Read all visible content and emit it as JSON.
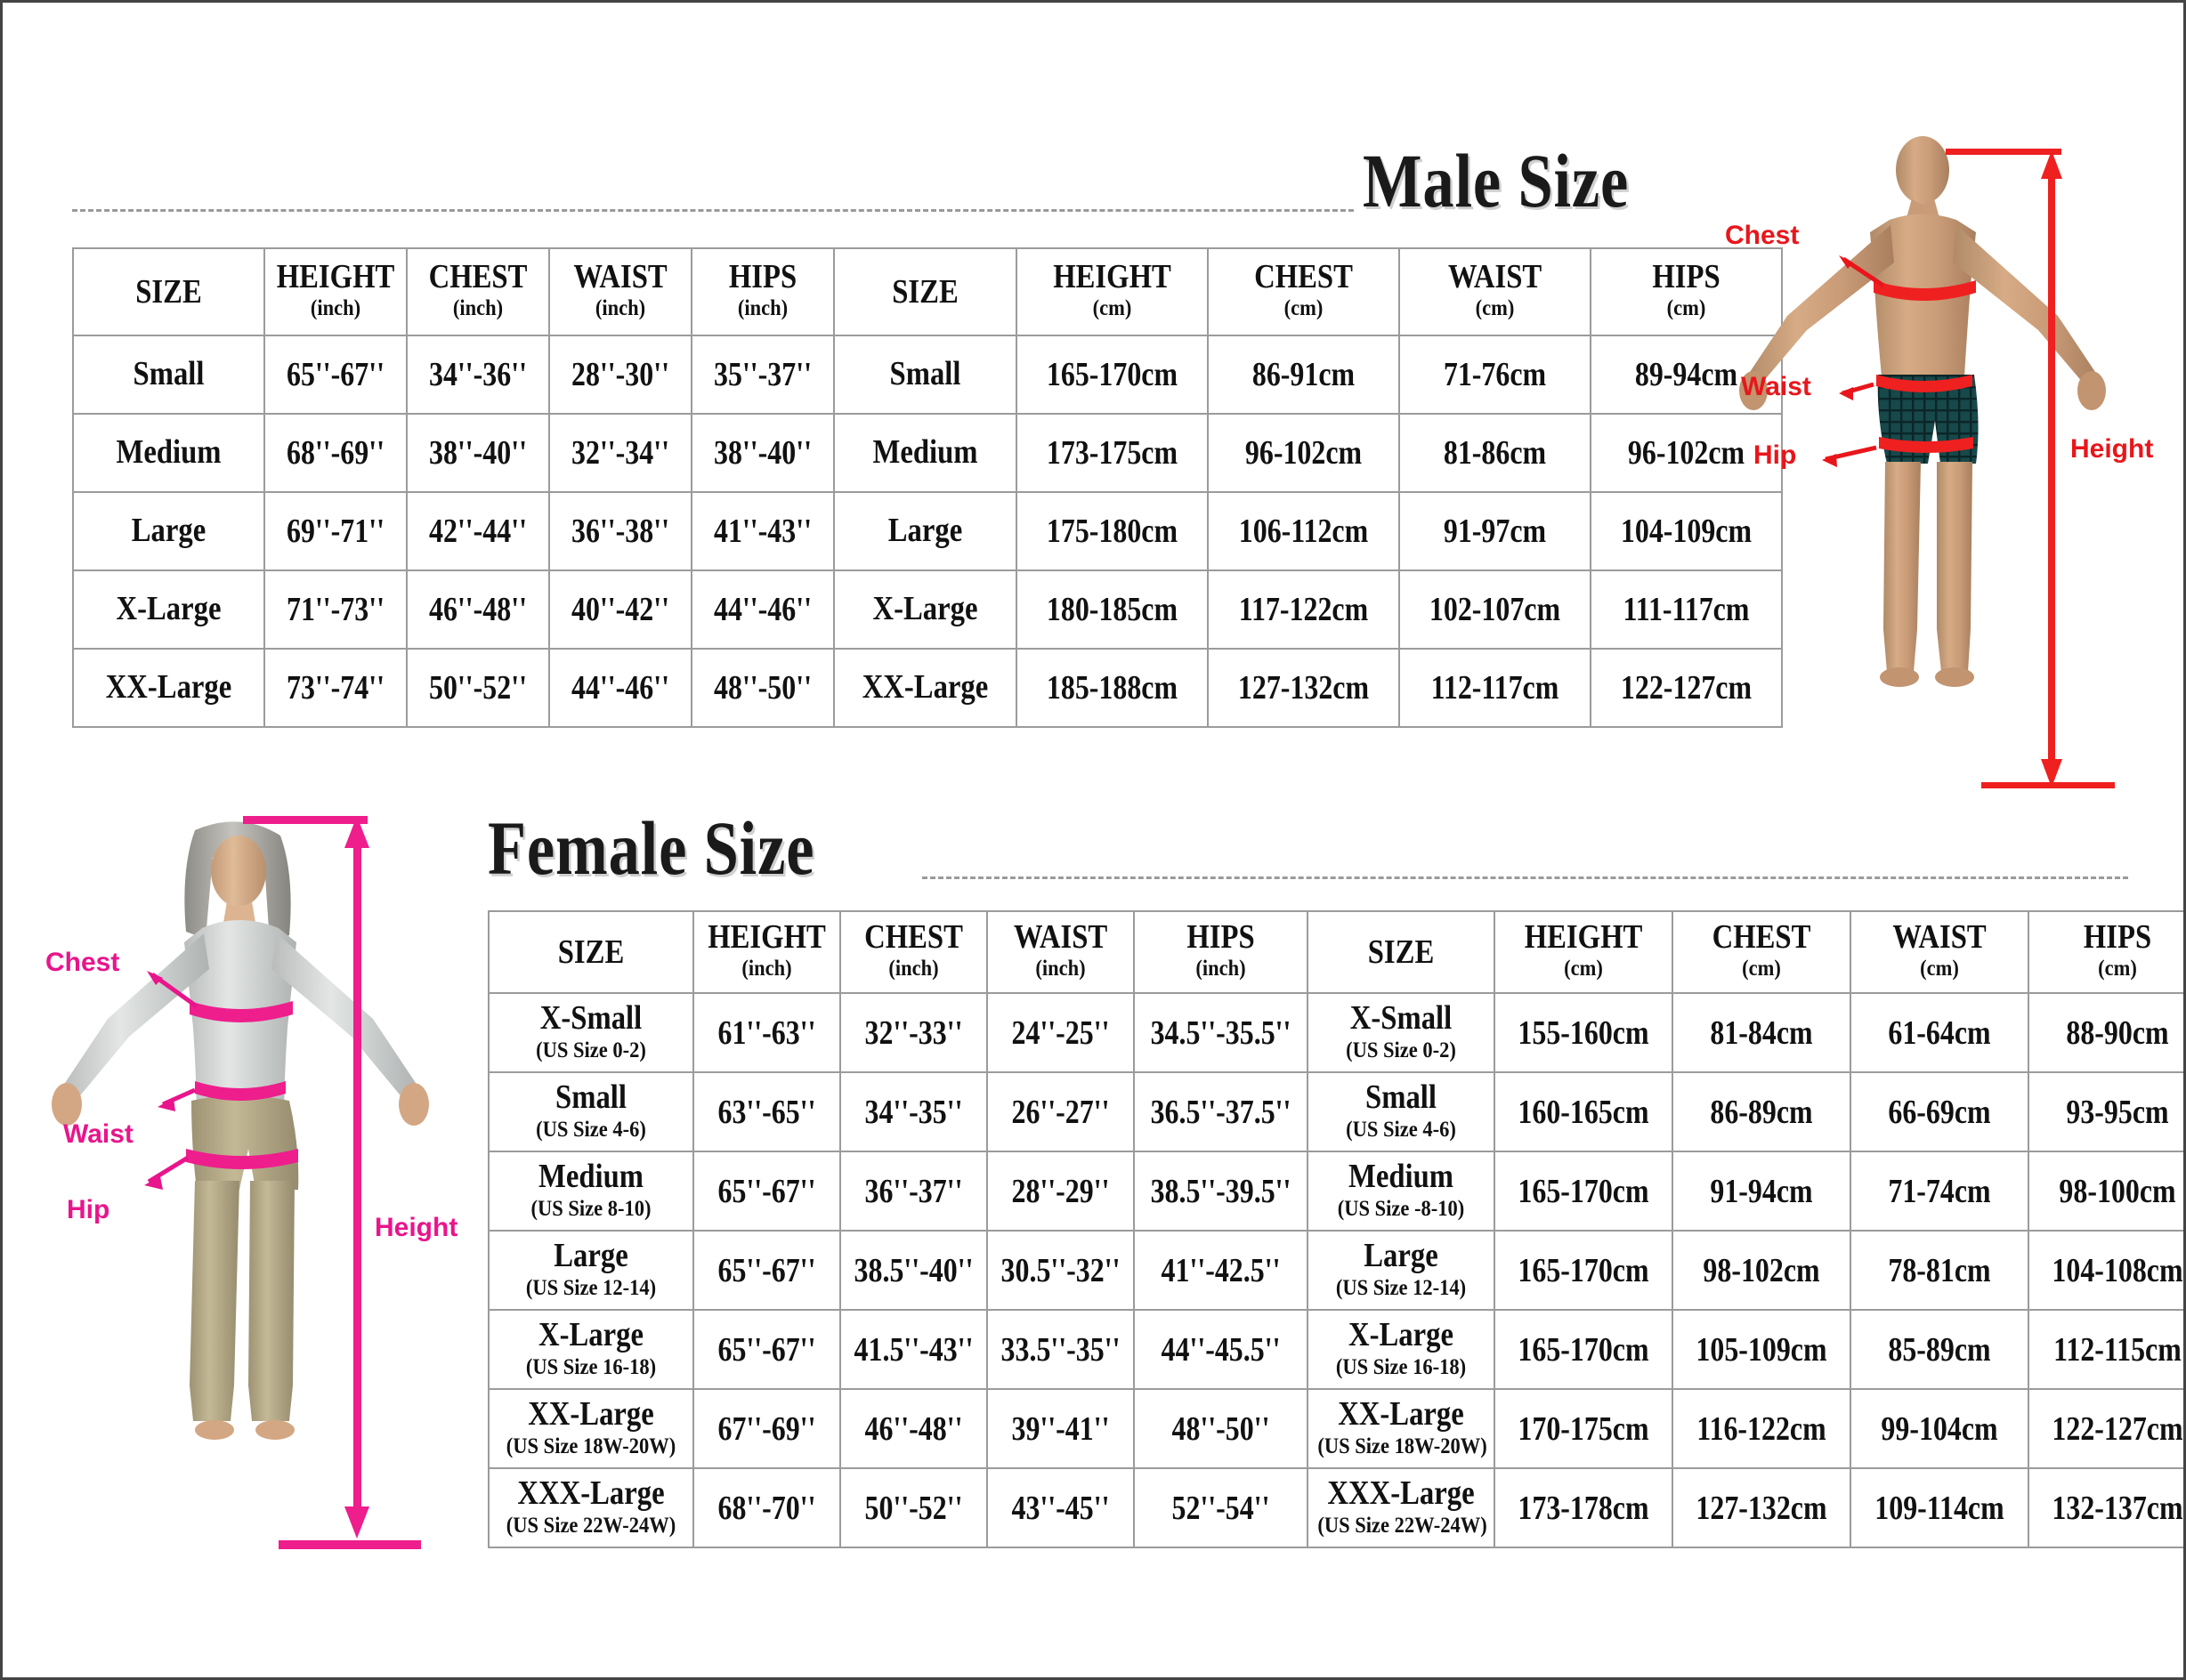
{
  "page": {
    "male_title": "Male Size",
    "female_title": "Female Size"
  },
  "colors": {
    "male_accent": "#e8161b",
    "female_accent": "#e8158c",
    "table_border": "#9b9b9b",
    "text": "#111111",
    "rule": "#9a9a9a"
  },
  "male_table": {
    "headers_inch": [
      {
        "main": "SIZE",
        "unit": ""
      },
      {
        "main": "HEIGHT",
        "unit": "(inch)"
      },
      {
        "main": "CHEST",
        "unit": "(inch)"
      },
      {
        "main": "WAIST",
        "unit": "(inch)"
      },
      {
        "main": "HIPS",
        "unit": "(inch)"
      }
    ],
    "headers_cm": [
      {
        "main": "SIZE",
        "unit": ""
      },
      {
        "main": "HEIGHT",
        "unit": "(cm)"
      },
      {
        "main": "CHEST",
        "unit": "(cm)"
      },
      {
        "main": "WAIST",
        "unit": "(cm)"
      },
      {
        "main": "HIPS",
        "unit": "(cm)"
      }
    ],
    "rows": [
      {
        "size_inch": "Small",
        "height_inch": "65''-67''",
        "chest_inch": "34''-36''",
        "waist_inch": "28''-30''",
        "hips_inch": "35''-37''",
        "size_cm": "Small",
        "height_cm": "165-170cm",
        "chest_cm": "86-91cm",
        "waist_cm": "71-76cm",
        "hips_cm": "89-94cm"
      },
      {
        "size_inch": "Medium",
        "height_inch": "68''-69''",
        "chest_inch": "38''-40''",
        "waist_inch": "32''-34''",
        "hips_inch": "38''-40''",
        "size_cm": "Medium",
        "height_cm": "173-175cm",
        "chest_cm": "96-102cm",
        "waist_cm": "81-86cm",
        "hips_cm": "96-102cm"
      },
      {
        "size_inch": "Large",
        "height_inch": "69''-71''",
        "chest_inch": "42''-44''",
        "waist_inch": "36''-38''",
        "hips_inch": "41''-43''",
        "size_cm": "Large",
        "height_cm": "175-180cm",
        "chest_cm": "106-112cm",
        "waist_cm": "91-97cm",
        "hips_cm": "104-109cm"
      },
      {
        "size_inch": "X-Large",
        "height_inch": "71''-73''",
        "chest_inch": "46''-48''",
        "waist_inch": "40''-42''",
        "hips_inch": "44''-46''",
        "size_cm": "X-Large",
        "height_cm": "180-185cm",
        "chest_cm": "117-122cm",
        "waist_cm": "102-107cm",
        "hips_cm": "111-117cm"
      },
      {
        "size_inch": "XX-Large",
        "height_inch": "73''-74''",
        "chest_inch": "50''-52''",
        "waist_inch": "44''-46''",
        "hips_inch": "48''-50''",
        "size_cm": "XX-Large",
        "height_cm": "185-188cm",
        "chest_cm": "127-132cm",
        "waist_cm": "112-117cm",
        "hips_cm": "122-127cm"
      }
    ]
  },
  "female_table": {
    "headers_inch": [
      {
        "main": "SIZE",
        "unit": ""
      },
      {
        "main": "HEIGHT",
        "unit": "(inch)"
      },
      {
        "main": "CHEST",
        "unit": "(inch)"
      },
      {
        "main": "WAIST",
        "unit": "(inch)"
      },
      {
        "main": "HIPS",
        "unit": "(inch)"
      }
    ],
    "headers_cm": [
      {
        "main": "SIZE",
        "unit": ""
      },
      {
        "main": "HEIGHT",
        "unit": "(cm)"
      },
      {
        "main": "CHEST",
        "unit": "(cm)"
      },
      {
        "main": "WAIST",
        "unit": "(cm)"
      },
      {
        "main": "HIPS",
        "unit": "(cm)"
      }
    ],
    "rows": [
      {
        "size_inch": "X-Small",
        "size_inch_sub": "(US Size 0-2)",
        "height_inch": "61''-63''",
        "chest_inch": "32''-33''",
        "waist_inch": "24''-25''",
        "hips_inch": "34.5''-35.5''",
        "size_cm": "X-Small",
        "size_cm_sub": "(US Size 0-2)",
        "height_cm": "155-160cm",
        "chest_cm": "81-84cm",
        "waist_cm": "61-64cm",
        "hips_cm": "88-90cm"
      },
      {
        "size_inch": "Small",
        "size_inch_sub": "(US Size 4-6)",
        "height_inch": "63''-65''",
        "chest_inch": "34''-35''",
        "waist_inch": "26''-27''",
        "hips_inch": "36.5''-37.5''",
        "size_cm": "Small",
        "size_cm_sub": "(US Size 4-6)",
        "height_cm": "160-165cm",
        "chest_cm": "86-89cm",
        "waist_cm": "66-69cm",
        "hips_cm": "93-95cm"
      },
      {
        "size_inch": "Medium",
        "size_inch_sub": "(US Size 8-10)",
        "height_inch": "65''-67''",
        "chest_inch": "36''-37''",
        "waist_inch": "28''-29''",
        "hips_inch": "38.5''-39.5''",
        "size_cm": "Medium",
        "size_cm_sub": "(US Size -8-10)",
        "height_cm": "165-170cm",
        "chest_cm": "91-94cm",
        "waist_cm": "71-74cm",
        "hips_cm": "98-100cm"
      },
      {
        "size_inch": "Large",
        "size_inch_sub": "(US Size 12-14)",
        "height_inch": "65''-67''",
        "chest_inch": "38.5''-40''",
        "waist_inch": "30.5''-32''",
        "hips_inch": "41''-42.5''",
        "size_cm": "Large",
        "size_cm_sub": "(US Size 12-14)",
        "height_cm": "165-170cm",
        "chest_cm": "98-102cm",
        "waist_cm": "78-81cm",
        "hips_cm": "104-108cm"
      },
      {
        "size_inch": "X-Large",
        "size_inch_sub": "(US Size 16-18)",
        "height_inch": "65''-67''",
        "chest_inch": "41.5''-43''",
        "waist_inch": "33.5''-35''",
        "hips_inch": "44''-45.5''",
        "size_cm": "X-Large",
        "size_cm_sub": "(US Size 16-18)",
        "height_cm": "165-170cm",
        "chest_cm": "105-109cm",
        "waist_cm": "85-89cm",
        "hips_cm": "112-115cm"
      },
      {
        "size_inch": "XX-Large",
        "size_inch_sub": "(US Size 18W-20W)",
        "height_inch": "67''-69''",
        "chest_inch": "46''-48''",
        "waist_inch": "39''-41''",
        "hips_inch": "48''-50''",
        "size_cm": "XX-Large",
        "size_cm_sub": "(US Size 18W-20W)",
        "height_cm": "170-175cm",
        "chest_cm": "116-122cm",
        "waist_cm": "99-104cm",
        "hips_cm": "122-127cm"
      },
      {
        "size_inch": "XXX-Large",
        "size_inch_sub": "(US Size 22W-24W)",
        "height_inch": "68''-70''",
        "chest_inch": "50''-52''",
        "waist_inch": "43''-45''",
        "hips_inch": "52''-54''",
        "size_cm": "XXX-Large",
        "size_cm_sub": "(US Size 22W-24W)",
        "height_cm": "173-178cm",
        "chest_cm": "127-132cm",
        "waist_cm": "109-114cm",
        "hips_cm": "132-137cm"
      }
    ]
  },
  "male_figure": {
    "labels": {
      "chest": "Chest",
      "waist": "Waist",
      "hip": "Hip",
      "height": "Height"
    }
  },
  "female_figure": {
    "labels": {
      "chest": "Chest",
      "waist": "Waist",
      "hip": "Hip",
      "height": "Height"
    }
  }
}
